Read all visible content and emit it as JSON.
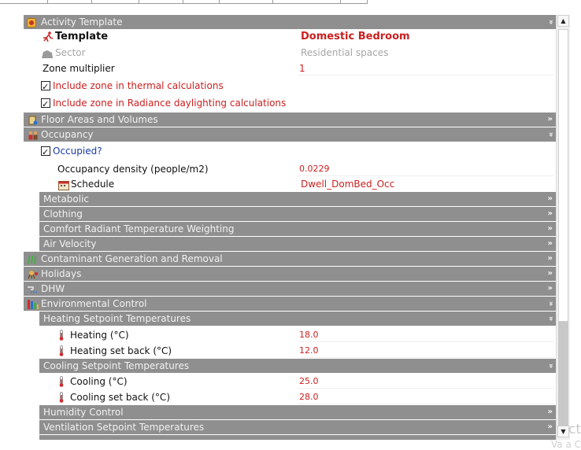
{
  "panel": {
    "sections": {
      "activity_template": {
        "label": "Activity Template",
        "chevron": "»"
      },
      "floor_areas": {
        "label": "Floor Areas and Volumes",
        "chevron": "»"
      },
      "occupancy": {
        "label": "Occupancy",
        "chevron": "»"
      },
      "metabolic": {
        "label": "Metabolic",
        "chevron": "»"
      },
      "clothing": {
        "label": "Clothing",
        "chevron": "»"
      },
      "comfort": {
        "label": "Comfort Radiant Temperature Weighting",
        "chevron": "»"
      },
      "air_velocity": {
        "label": "Air Velocity",
        "chevron": "»"
      },
      "contaminant": {
        "label": "Contaminant Generation and Removal",
        "chevron": "»"
      },
      "holidays": {
        "label": "Holidays",
        "chevron": "»"
      },
      "dhw": {
        "label": "DHW",
        "chevron": "»"
      },
      "environmental": {
        "label": "Environmental Control",
        "chevron": "»"
      },
      "heating_setpoints": {
        "label": "Heating Setpoint Temperatures",
        "chevron": "»"
      },
      "cooling_setpoints": {
        "label": "Cooling Setpoint Temperatures",
        "chevron": "»"
      },
      "humidity": {
        "label": "Humidity Control",
        "chevron": "»"
      },
      "ventilation": {
        "label": "Ventilation Setpoint Temperatures",
        "chevron": "»"
      }
    },
    "fields": {
      "template": {
        "label": "Template",
        "value": "Domestic Bedroom"
      },
      "sector": {
        "label": "Sector",
        "value": "Residential spaces"
      },
      "zone_multiplier": {
        "label": "Zone multiplier",
        "value": "1"
      },
      "include_thermal": {
        "label": "Include zone in thermal calculations",
        "checked": true
      },
      "include_radiance": {
        "label": "Include zone in Radiance daylighting calculations",
        "checked": true
      },
      "occupied": {
        "label": "Occupied?",
        "checked": true
      },
      "occupancy_density": {
        "label": "Occupancy density (people/m2)",
        "value": "0.0229"
      },
      "schedule": {
        "label": "Schedule",
        "value": "Dwell_DomBed_Occ"
      },
      "heating": {
        "label": "Heating (°C)",
        "value": "18.0"
      },
      "heating_setback": {
        "label": "Heating set back (°C)",
        "value": "12.0"
      },
      "cooling": {
        "label": "Cooling (°C)",
        "value": "25.0"
      },
      "cooling_setback": {
        "label": "Cooling set back (°C)",
        "value": "28.0"
      }
    }
  },
  "watermark": {
    "line1": "ctiv",
    "line2": "Va a C"
  },
  "icons": {
    "activity": "activity-template-icon",
    "template": "running-figure-icon",
    "sector": "sector-icon",
    "floor": "floor-areas-icon",
    "occupancy": "people-icon",
    "schedule": "schedule-icon",
    "contaminant": "contaminant-icon",
    "holidays": "holidays-icon",
    "dhw": "dhw-icon",
    "environmental": "environmental-control-icon",
    "thermometer": "thermometer-icon"
  },
  "colors": {
    "header_bg": "#8f8f8f",
    "value_red": "#cc1f1f",
    "link_blue": "#1a3aa8"
  }
}
